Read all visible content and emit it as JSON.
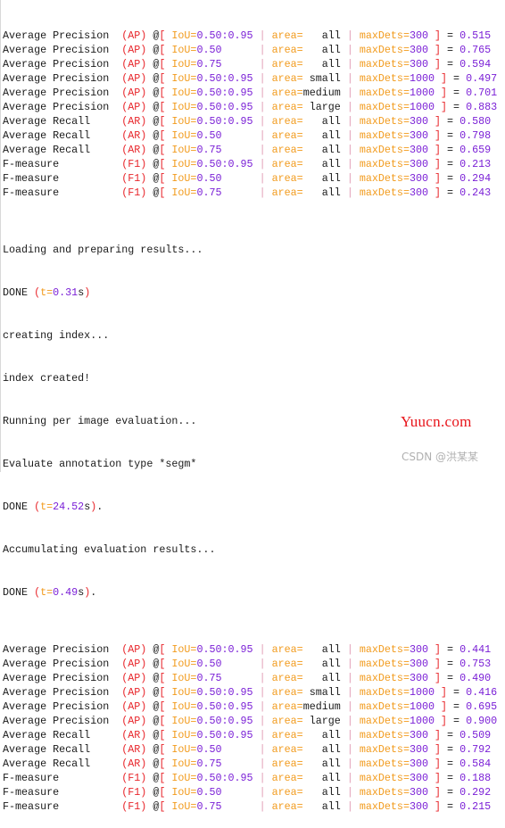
{
  "console": {
    "block1": [
      {
        "label": "Average Precision ",
        "metric": "(AP)",
        "iou": "0.50:0.95",
        "area": "   all",
        "maxdets": "300 ",
        "value": "0.515"
      },
      {
        "label": "Average Precision ",
        "metric": "(AP)",
        "iou": "0.50     ",
        "area": "   all",
        "maxdets": "300 ",
        "value": "0.765"
      },
      {
        "label": "Average Precision ",
        "metric": "(AP)",
        "iou": "0.75     ",
        "area": "   all",
        "maxdets": "300 ",
        "value": "0.594"
      },
      {
        "label": "Average Precision ",
        "metric": "(AP)",
        "iou": "0.50:0.95",
        "area": " small",
        "maxdets": "1000 ",
        "value": "0.497"
      },
      {
        "label": "Average Precision ",
        "metric": "(AP)",
        "iou": "0.50:0.95",
        "area": "medium",
        "maxdets": "1000 ",
        "value": "0.701"
      },
      {
        "label": "Average Precision ",
        "metric": "(AP)",
        "iou": "0.50:0.95",
        "area": " large",
        "maxdets": "1000 ",
        "value": "0.883"
      },
      {
        "label": "Average Recall    ",
        "metric": "(AR)",
        "iou": "0.50:0.95",
        "area": "   all",
        "maxdets": "300 ",
        "value": "0.580"
      },
      {
        "label": "Average Recall    ",
        "metric": "(AR)",
        "iou": "0.50     ",
        "area": "   all",
        "maxdets": "300 ",
        "value": "0.798"
      },
      {
        "label": "Average Recall    ",
        "metric": "(AR)",
        "iou": "0.75     ",
        "area": "   all",
        "maxdets": "300 ",
        "value": "0.659"
      },
      {
        "label": "F-measure         ",
        "metric": "(F1)",
        "iou": "0.50:0.95",
        "area": "   all",
        "maxdets": "300 ",
        "value": "0.213"
      },
      {
        "label": "F-measure         ",
        "metric": "(F1)",
        "iou": "0.50     ",
        "area": "   all",
        "maxdets": "300 ",
        "value": "0.294"
      },
      {
        "label": "F-measure         ",
        "metric": "(F1)",
        "iou": "0.75     ",
        "area": "   all",
        "maxdets": "300 ",
        "value": "0.243"
      }
    ],
    "log": {
      "loading": "Loading and preparing results...",
      "done1_prefix": "DONE ",
      "done1_t": "0.31",
      "done1_suffix": "",
      "creating_index": "creating index...",
      "index_created": "index created!",
      "running": "Running per image evaluation...",
      "evaluate_type": "Evaluate annotation type *segm*",
      "done2_prefix": "DONE ",
      "done2_t": "24.52",
      "done2_suffix": ".",
      "accumulating": "Accumulating evaluation results...",
      "done3_prefix": "DONE ",
      "done3_t": "0.49",
      "done3_suffix": "."
    },
    "block2": [
      {
        "label": "Average Precision ",
        "metric": "(AP)",
        "iou": "0.50:0.95",
        "area": "   all",
        "maxdets": "300 ",
        "value": "0.441"
      },
      {
        "label": "Average Precision ",
        "metric": "(AP)",
        "iou": "0.50     ",
        "area": "   all",
        "maxdets": "300 ",
        "value": "0.753"
      },
      {
        "label": "Average Precision ",
        "metric": "(AP)",
        "iou": "0.75     ",
        "area": "   all",
        "maxdets": "300 ",
        "value": "0.490"
      },
      {
        "label": "Average Precision ",
        "metric": "(AP)",
        "iou": "0.50:0.95",
        "area": " small",
        "maxdets": "1000 ",
        "value": "0.416"
      },
      {
        "label": "Average Precision ",
        "metric": "(AP)",
        "iou": "0.50:0.95",
        "area": "medium",
        "maxdets": "1000 ",
        "value": "0.695"
      },
      {
        "label": "Average Precision ",
        "metric": "(AP)",
        "iou": "0.50:0.95",
        "area": " large",
        "maxdets": "1000 ",
        "value": "0.900"
      },
      {
        "label": "Average Recall    ",
        "metric": "(AR)",
        "iou": "0.50:0.95",
        "area": "   all",
        "maxdets": "300 ",
        "value": "0.509"
      },
      {
        "label": "Average Recall    ",
        "metric": "(AR)",
        "iou": "0.50     ",
        "area": "   all",
        "maxdets": "300 ",
        "value": "0.792"
      },
      {
        "label": "Average Recall    ",
        "metric": "(AR)",
        "iou": "0.75     ",
        "area": "   all",
        "maxdets": "300 ",
        "value": "0.584"
      },
      {
        "label": "F-measure         ",
        "metric": "(F1)",
        "iou": "0.50:0.95",
        "area": "   all",
        "maxdets": "300 ",
        "value": "0.188"
      },
      {
        "label": "F-measure         ",
        "metric": "(F1)",
        "iou": "0.50     ",
        "area": "   all",
        "maxdets": "300 ",
        "value": "0.292"
      },
      {
        "label": "F-measure         ",
        "metric": "(F1)",
        "iou": "0.75     ",
        "area": "   all",
        "maxdets": "300 ",
        "value": "0.215"
      }
    ],
    "tokens": {
      "at_bracket": "@",
      "open_bracket": "[",
      "iou_key": "IoU=",
      "area_key": "area=",
      "maxdets_key": "maxDets=",
      "pipe": "|",
      "close_bracket": "]",
      "equals": " = ",
      "t_key": "t=",
      "t_unit": "s",
      "paren_open": "(",
      "paren_close": ")"
    }
  },
  "watermarks": {
    "site": "Yuucn.com",
    "csdn": "CSDN @洪某某"
  }
}
